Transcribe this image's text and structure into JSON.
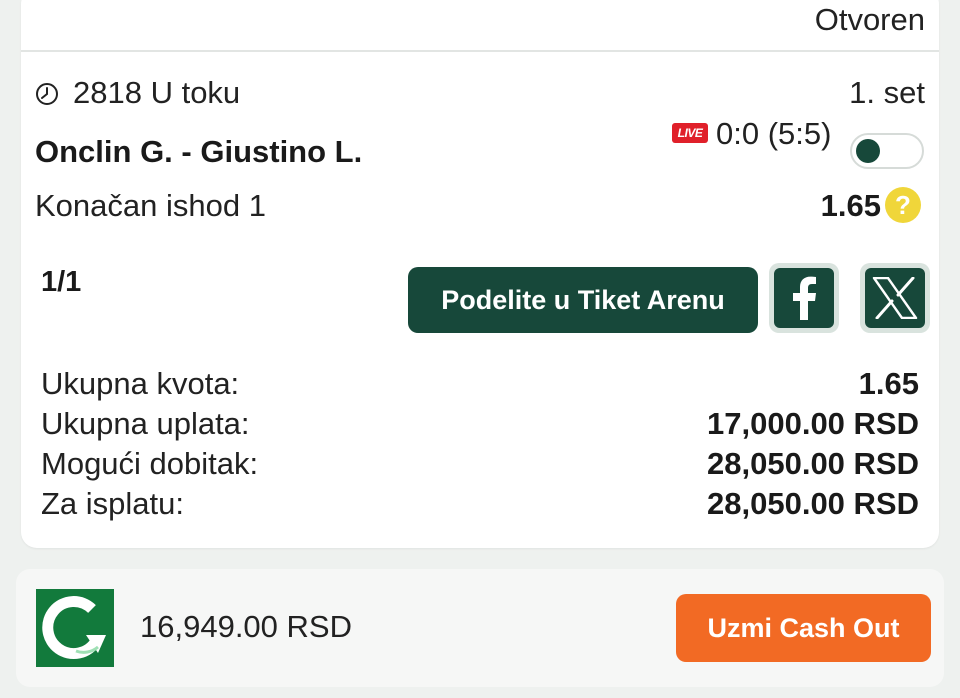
{
  "ticket": {
    "status": "Otvoren",
    "event": {
      "id_status": "2818 U toku",
      "period": "1. set",
      "match": "Onclin G. - Giustino L.",
      "live_badge": "LIVE",
      "score": "0:0 (5:5)",
      "pick": "Konačan ishod 1",
      "odds": "1.65",
      "help_glyph": "?"
    },
    "counter": "1/1",
    "share_button_label": "Podelite u Tiket Arenu",
    "summary": [
      {
        "label": "Ukupna kvota:",
        "value": "1.65"
      },
      {
        "label": "Ukupna uplata:",
        "value": "17,000.00 RSD"
      },
      {
        "label": "Mogući dobitak:",
        "value": "28,050.00 RSD"
      },
      {
        "label": "Za isplatu:",
        "value": "28,050.00 RSD"
      }
    ]
  },
  "cashout": {
    "amount": "16,949.00 RSD",
    "button_label": "Uzmi Cash Out"
  },
  "colors": {
    "brand_dark_green": "#17483a",
    "live_red": "#e0202a",
    "cashout_orange": "#f26a24",
    "help_yellow": "#f0d63a",
    "logo_green": "#127a3c"
  },
  "icons": {
    "clock": "clock-icon",
    "facebook": "facebook-icon",
    "x": "x-logo-icon",
    "cashout_logo": "cashout-logo-icon",
    "help": "help-icon"
  }
}
